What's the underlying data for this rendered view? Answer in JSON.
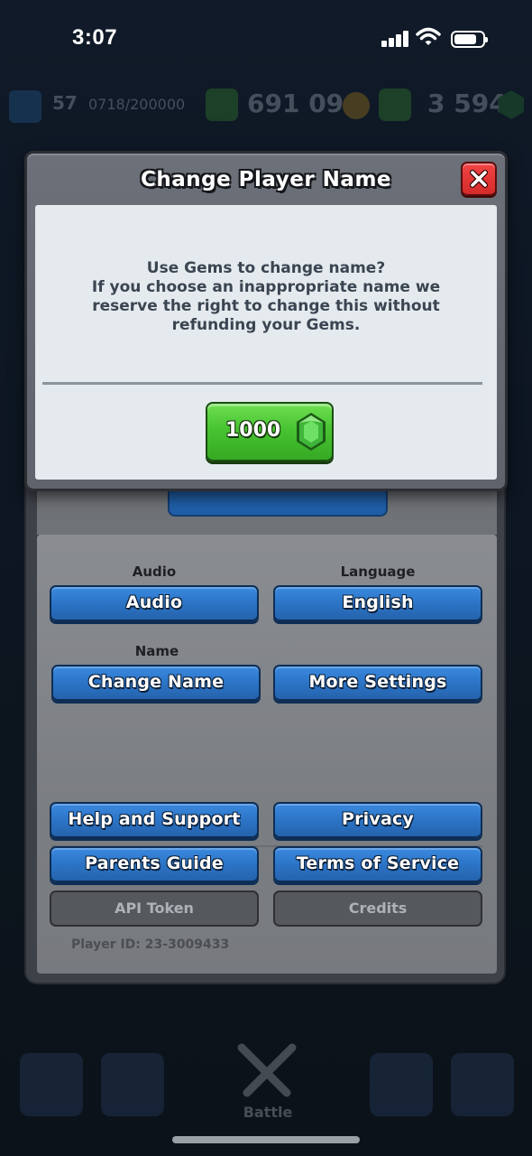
{
  "status_bar": {
    "time": "3:07",
    "battery_level": 0.8
  },
  "background": {
    "hud": {
      "level": "57",
      "xp": "0718/200000",
      "gold": "691 090",
      "gems": "3 594"
    },
    "nav": {
      "battle_label": "Battle"
    }
  },
  "dialog": {
    "title": "Change Player Name",
    "message_lines": [
      "Use Gems to change name?",
      "If you choose an inappropriate name we",
      "reserve the right to change this without",
      "refunding your Gems."
    ],
    "confirm_cost": "1000",
    "colors": {
      "confirm": "#48c331",
      "close": "#d42a2a"
    }
  },
  "settings": {
    "audio_label": "Audio",
    "audio_button": "Audio",
    "language_label": "Language",
    "language_button": "English",
    "name_label": "Name",
    "change_name_button": "Change Name",
    "more_settings_button": "More Settings",
    "help_button": "Help and Support",
    "privacy_button": "Privacy",
    "parents_button": "Parents Guide",
    "terms_button": "Terms of Service",
    "api_button": "API Token",
    "credits_button": "Credits",
    "player_id": "Player ID: 23-3009433",
    "colors": {
      "button_blue": "#2c74c6",
      "button_disabled": "#55585d"
    }
  }
}
